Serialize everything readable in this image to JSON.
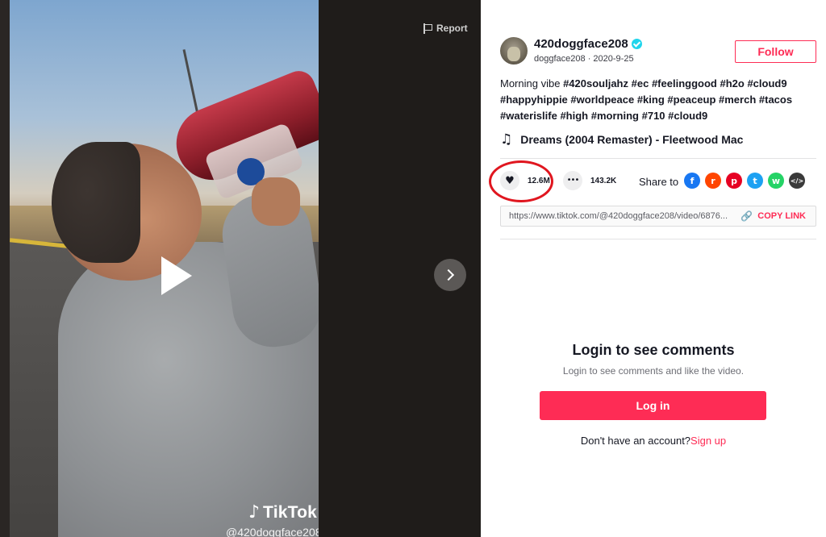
{
  "video": {
    "report_label": "Report",
    "watermark_brand": "TikTok",
    "watermark_handle": "@420doggface208",
    "play_icon": "play-icon",
    "next_icon": "chevron-right-icon"
  },
  "author": {
    "username": "420doggface208",
    "nickname": "doggface208",
    "date": "2020-9-25",
    "verified": true,
    "follow_label": "Follow"
  },
  "caption": {
    "text": "Morning vibe",
    "tags": [
      "#420souljahz",
      "#ec",
      "#feelinggood",
      "#h2o",
      "#cloud9",
      "#happyhippie",
      "#worldpeace",
      "#king",
      "#peaceup",
      "#merch",
      "#tacos",
      "#waterislife",
      "#high",
      "#morning",
      "#710",
      "#cloud9"
    ]
  },
  "music": {
    "icon": "music-note-icon",
    "title": "Dreams (2004 Remaster) - Fleetwood Mac"
  },
  "actions": {
    "likes": "12.6M",
    "comments": "143.2K",
    "share_label": "Share to",
    "share_targets": [
      {
        "name": "facebook",
        "glyph": "f",
        "color": "#1877f2"
      },
      {
        "name": "reddit",
        "glyph": "r",
        "color": "#ff4500"
      },
      {
        "name": "pinterest",
        "glyph": "p",
        "color": "#e60023"
      },
      {
        "name": "twitter",
        "glyph": "t",
        "color": "#1da1f2"
      },
      {
        "name": "whatsapp",
        "glyph": "w",
        "color": "#25d366"
      },
      {
        "name": "embed",
        "glyph": "</>",
        "color": "#3a3a3a"
      }
    ]
  },
  "link": {
    "url": "https://www.tiktok.com/@420doggface208/video/6876...",
    "copy_label": "COPY LINK"
  },
  "comments_gate": {
    "title": "Login to see comments",
    "subtitle": "Login to see comments and like the video.",
    "login_label": "Log in",
    "no_account_text": "Don't have an account?",
    "signup_label": "Sign up"
  },
  "colors": {
    "accent": "#fe2c55",
    "highlight_ring": "#e0161f"
  }
}
